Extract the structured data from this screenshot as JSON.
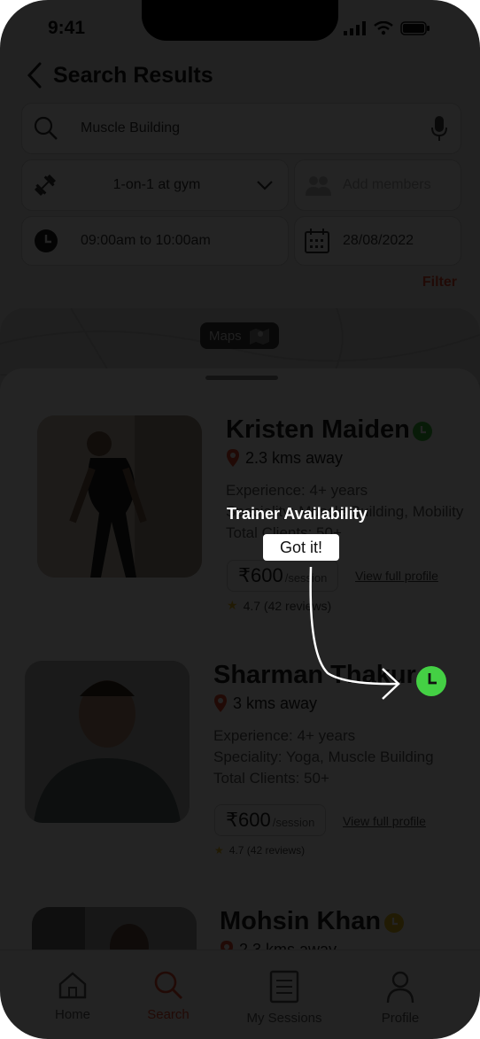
{
  "status": {
    "time": "9:41"
  },
  "header": {
    "title": "Search Results"
  },
  "search": {
    "value": "Muscle Building"
  },
  "filters": {
    "session_type": "1-on-1 at gym",
    "members_placeholder": "Add members",
    "time_range": "09:00am to 10:00am",
    "date": "28/08/2022",
    "filter_label": "Filter"
  },
  "map": {
    "label": "Maps"
  },
  "trainers": [
    {
      "name": "Kristen Maiden",
      "distance": "2.3 kms away",
      "experience": "Experience: 4+ years",
      "speciality": "Speciality: Muscle Building, Mobility",
      "clients": "Total Clients: 50+",
      "price": "₹600",
      "price_unit": "/session",
      "profile_link": "View full profile",
      "rating": "4.7 (42 reviews)",
      "availability_color": "#3bbf3b"
    },
    {
      "name": "Sharman Thakur",
      "distance": "3 kms away",
      "experience": "Experience: 4+ years",
      "speciality": "Speciality: Yoga, Muscle Building",
      "clients": "Total Clients: 50+",
      "price": "₹600",
      "price_unit": "/session",
      "profile_link": "View full profile",
      "rating": "4.7 (42 reviews)",
      "availability_color": "#3bbf3b"
    },
    {
      "name": "Mohsin Khan",
      "distance": "2.3 kms away",
      "availability_color": "#e8c020"
    }
  ],
  "coachmark": {
    "title": "Trainer Availability",
    "button": "Got it!"
  },
  "tabbar": {
    "items": [
      {
        "label": "Home",
        "icon": "home-icon"
      },
      {
        "label": "Search",
        "icon": "search-icon"
      },
      {
        "label": "My Sessions",
        "icon": "sessions-icon"
      },
      {
        "label": "Profile",
        "icon": "profile-icon"
      }
    ]
  },
  "colors": {
    "accent": "#e8472a",
    "available": "#3bbf3b",
    "busy": "#e8c020"
  }
}
